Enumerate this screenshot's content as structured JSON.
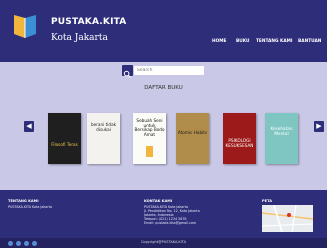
{
  "header": {
    "brand": "PUSTAKA.KITA",
    "city": "Kota Jakarta",
    "nav": [
      "HOME",
      "BUKU",
      "TENTANG KAMI",
      "BANTUAN"
    ]
  },
  "search": {
    "placeholder": "Search"
  },
  "catalog": {
    "title": "DAFTAR BUKU",
    "books": [
      {
        "title": "Filosofi Teras",
        "cover_bg": "#1f1f1f",
        "text_color": "#f2c44f"
      },
      {
        "title": "berani tidak disukai",
        "cover_bg": "#f4f2ee",
        "text_color": "#222222"
      },
      {
        "title": "Sebuah Seni untuk Bersikap Bodo Amat",
        "cover_bg": "#fbfbf7",
        "text_color": "#111111"
      },
      {
        "title": "Atomic Habits",
        "cover_bg": "#b08d4a",
        "text_color": "#1a1a1a"
      },
      {
        "title": "PSIKOLOGI KESUKSESAN",
        "cover_bg": "#9d1a1a",
        "text_color": "#ffffff"
      },
      {
        "title": "Kesehatan Mental",
        "cover_bg": "#7fc6c2",
        "text_color": "#ffffff"
      }
    ]
  },
  "footer": {
    "about_title": "TENTANG KAMI",
    "about_text": "PUSTAKA.KITA Kota Jakarta",
    "contact_title": "KONTAK KAMI",
    "contact_lines": [
      "PUSTAKA.KITA Kota Jakarta",
      "Jl. Pendidikan No. 12, Kota Jakarta",
      "Jakarta, Indonesia",
      "Telepon: (021) 1234 5678",
      "Email: pustaka.kita@gmail.com"
    ],
    "map_title": "PETA",
    "copyright": "Copyright@PUSTAKA.KITA"
  },
  "colors": {
    "primary": "#2e2d7a",
    "page_bg": "#c9c8e6"
  }
}
